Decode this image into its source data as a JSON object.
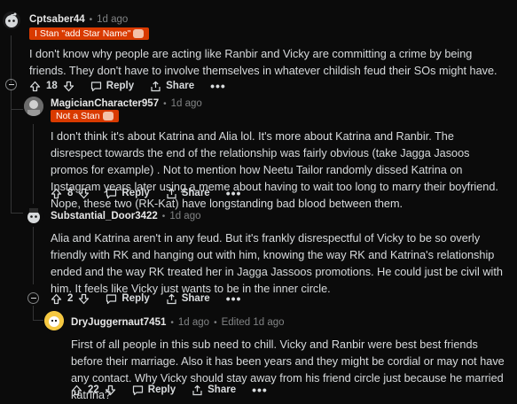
{
  "comments": [
    {
      "user": "Cptsaber44",
      "time": "1d ago",
      "flair": "I Stan \"add Star Name\"",
      "body": [
        "I don't know why people are acting like Ranbir and Vicky are committing a crime by being friends. They don't have to involve themselves in whatever childish feud their SOs might have."
      ],
      "votes": "18",
      "reply": "Reply",
      "share": "Share",
      "more": "•••"
    },
    {
      "user": "MagicianCharacter957",
      "time": "1d ago",
      "flair": "Not a Stan",
      "body": [
        "I don't think it's about Katrina and Alia lol. It's more about Katrina and Ranbir. The disrespect towards the end of the relationship was fairly obvious (take Jagga Jasoos promos for example) . Not to mention how Neetu Tailor randomly dissed Katrina on Instagram years later using a meme about having to wait too long to marry their boyfriend. Nope, these two (RK-Kat) have longstanding bad blood between them."
      ],
      "votes": "8",
      "reply": "Reply",
      "share": "Share",
      "more": "•••"
    },
    {
      "user": "Substantial_Door3422",
      "time": "1d ago",
      "body": [
        "Alia and Katrina aren't in any feud. But it's frankly disrespectful of Vicky to be so overly friendly with RK and hanging out with him, knowing the way RK and Katrina's relationship ended and the way RK treated her in Jagga Jassoos promotions. He could just be civil with him. It feels like Vicky just wants to be in the inner circle."
      ],
      "votes": "2",
      "reply": "Reply",
      "share": "Share",
      "more": "•••"
    },
    {
      "user": "DryJuggernaut7451",
      "time": "1d ago",
      "edited": "Edited 1d ago",
      "body": [
        "First of all people in this sub need to chill. Vicky and Ranbir were best best friends before their marriage. Also it has been years and they might be cordial or may not have any contact. Why Vicky should stay away from his friend circle just because he married katrina?"
      ],
      "votes": "22",
      "reply": "Reply",
      "share": "Share",
      "more": "•••"
    }
  ],
  "icons": {
    "upvote": "arrow-up-icon",
    "downvote": "arrow-down-icon",
    "reply": "speech-bubble-icon",
    "share": "share-icon",
    "collapse": "minus-circle-icon"
  }
}
